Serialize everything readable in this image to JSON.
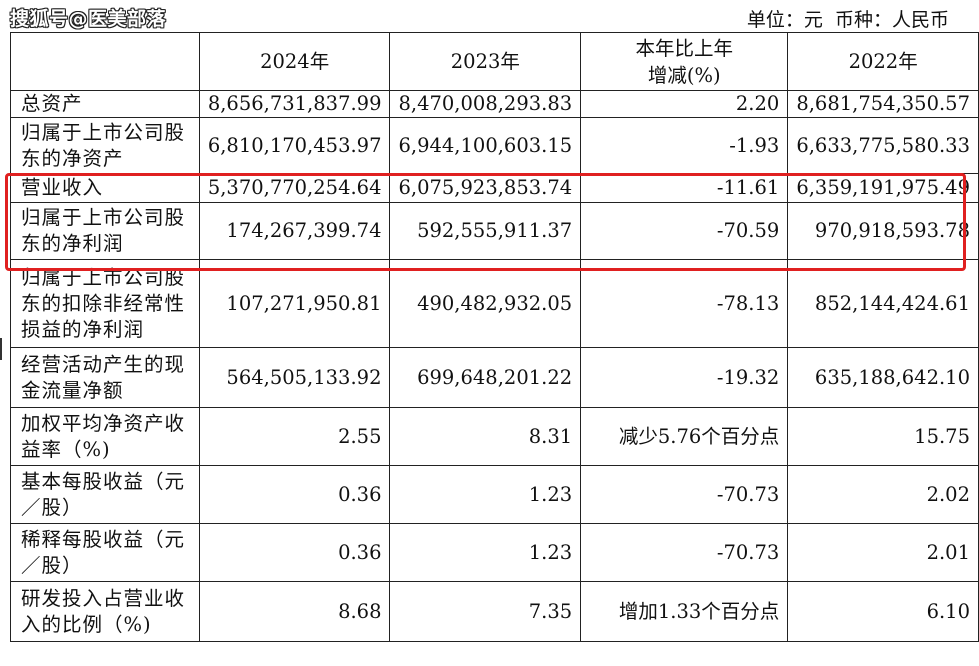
{
  "watermark": "搜狐号@医美部落",
  "unit": {
    "unit_label": "单位：元",
    "currency_label": "币种：人民币"
  },
  "table": {
    "headers": [
      "",
      "2024年",
      "2023年",
      "本年比上年\n增减(%)",
      "2022年"
    ],
    "rows": [
      {
        "label": "总资产",
        "values": [
          "8,656,731,837.99",
          "8,470,008,293.83",
          "2.20",
          "8,681,754,350.57"
        ]
      },
      {
        "label": "归属于上市公司股\n东的净资产",
        "values": [
          "6,810,170,453.97",
          "6,944,100,603.15",
          "-1.93",
          "6,633,775,580.33"
        ]
      },
      {
        "label": "营业收入",
        "values": [
          "5,370,770,254.64",
          "6,075,923,853.74",
          "-11.61",
          "6,359,191,975.49"
        ]
      },
      {
        "label": "归属于上市公司股\n东的净利润",
        "values": [
          "174,267,399.74",
          "592,555,911.37",
          "-70.59",
          "970,918,593.78"
        ]
      },
      {
        "label": "归属于上市公司股\n东的扣除非经常性\n损益的净利润",
        "values": [
          "107,271,950.81",
          "490,482,932.05",
          "-78.13",
          "852,144,424.61"
        ]
      },
      {
        "label": "经营活动产生的现\n金流量净额",
        "values": [
          "564,505,133.92",
          "699,648,201.22",
          "-19.32",
          "635,188,642.10"
        ]
      },
      {
        "label": "加权平均净资产收\n益率（%)",
        "values": [
          "2.55",
          "8.31",
          "减少5.76个百分点",
          "15.75"
        ]
      },
      {
        "label": "基本每股收益（元\n／股）",
        "values": [
          "0.36",
          "1.23",
          "-70.73",
          "2.02"
        ]
      },
      {
        "label": "稀释每股收益（元\n／股）",
        "values": [
          "0.36",
          "1.23",
          "-70.73",
          "2.01"
        ]
      },
      {
        "label": "研发投入占营业收\n入的比例（%)",
        "values": [
          "8.68",
          "7.35",
          "增加1.33个百分点",
          "6.10"
        ]
      }
    ]
  },
  "highlight_color": "#e02020"
}
